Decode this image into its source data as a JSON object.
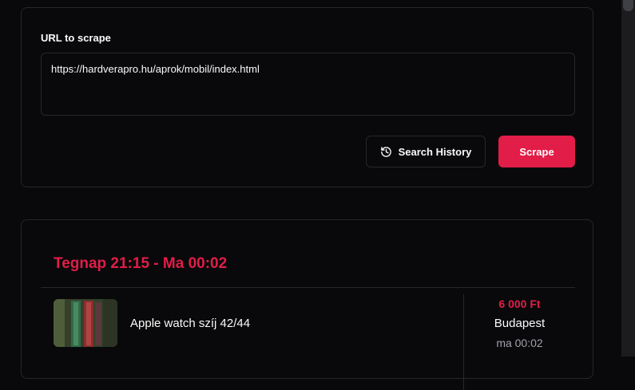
{
  "form": {
    "url_label": "URL to scrape",
    "url_value": "https://hardverapro.hu/aprok/mobil/index.html",
    "history_button": "Search History",
    "history_icon": "history-icon",
    "scrape_button": "Scrape",
    "accent_color": "#e11d48"
  },
  "results": {
    "range_title": "Tegnap 21:15 - Ma 00:02",
    "items": [
      {
        "title": "Apple watch szíj 42/44",
        "price": "6 000 Ft",
        "city": "Budapest",
        "time": "ma 00:02"
      }
    ]
  }
}
